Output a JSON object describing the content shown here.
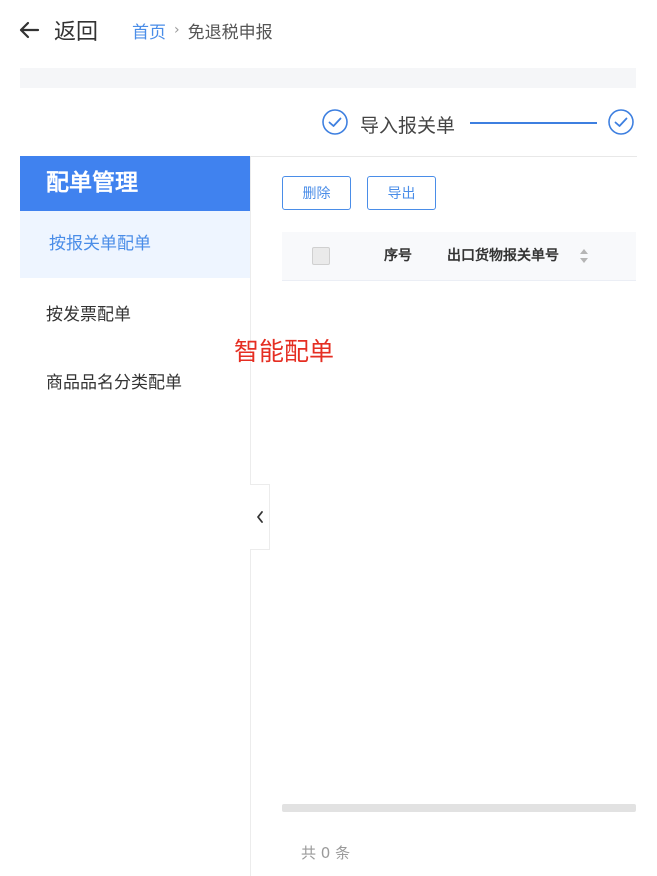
{
  "header": {
    "back_label": "返回",
    "breadcrumb": {
      "home": "首页",
      "separator": "›",
      "current": "免退税申报"
    }
  },
  "steps": [
    {
      "label": "导入报关单",
      "status": "done"
    },
    {
      "label": "",
      "status": "done"
    }
  ],
  "sidebar": {
    "title": "配单管理",
    "items": [
      {
        "label": "按报关单配单",
        "active": true
      },
      {
        "label": "按发票配单",
        "active": false
      },
      {
        "label": "商品品名分类配单",
        "active": false
      }
    ]
  },
  "toolbar": {
    "delete_label": "删除",
    "export_label": "导出"
  },
  "table": {
    "columns": [
      "序号",
      "出口货物报关单号"
    ],
    "rows": []
  },
  "annotation": "智能配单",
  "pagination": {
    "total_text": "共 0 条"
  },
  "colors": {
    "accent": "#4082ef",
    "annotation": "#e52e22"
  },
  "icons": [
    "back-arrow-icon",
    "check-circle-icon",
    "chevron-left-icon",
    "sort-icon"
  ]
}
